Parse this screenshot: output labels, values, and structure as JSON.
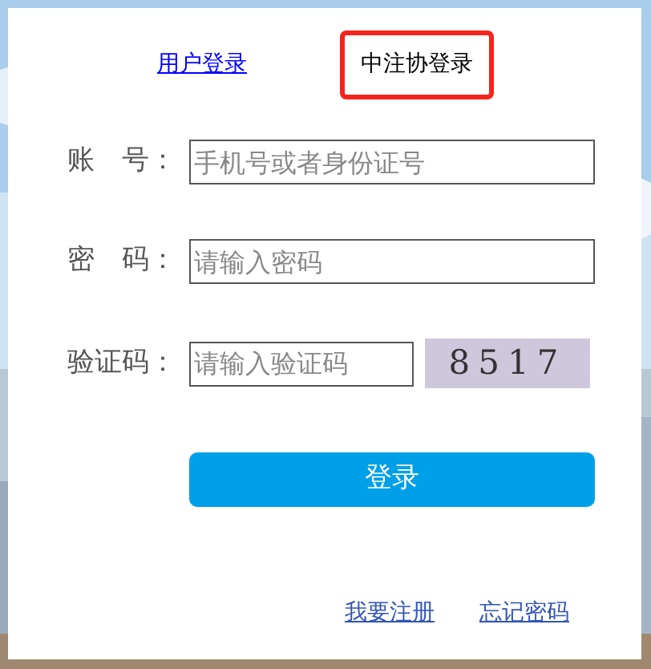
{
  "tabs": [
    {
      "label": "用户登录",
      "selected": false
    },
    {
      "label": "中注协登录",
      "selected": true
    }
  ],
  "fields": [
    {
      "kind": "text",
      "label": "账　号：",
      "placeholder": "手机号或者身份证号"
    },
    {
      "kind": "password",
      "label": "密　码：",
      "placeholder": "请输入密码"
    },
    {
      "kind": "captcha",
      "label": "验证码：",
      "placeholder": "请输入验证码",
      "captcha": "8517"
    }
  ],
  "submit": "登录",
  "links": [
    "我要注册",
    "忘记密码"
  ]
}
